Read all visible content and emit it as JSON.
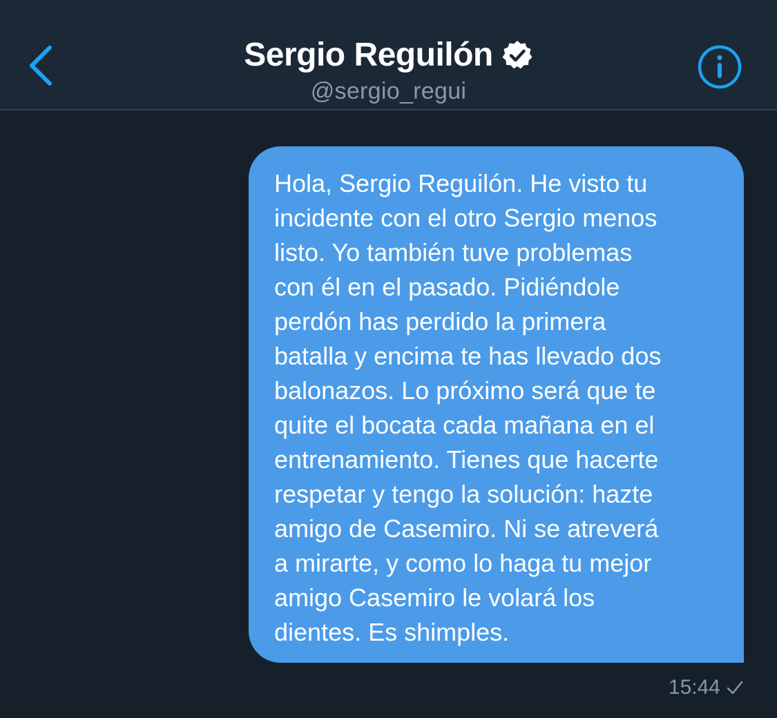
{
  "header": {
    "name": "Sergio Reguilón",
    "handle": "@sergio_regui",
    "back_icon": "chevron-left-icon",
    "verified_icon": "verified-badge-icon",
    "info_icon": "info-icon"
  },
  "conversation": {
    "messages": [
      {
        "text": "Hola, Sergio Reguilón. He visto tu\nincidente con el otro Sergio menos\nlisto. Yo también tuve problemas\ncon él en el pasado. Pidiéndole\nperdón has perdido la primera\nbatalla y encima te has llevado dos\nbalonazos. Lo próximo será que te\nquite el bocata cada mañana en el\nentrenamiento. Tienes que hacerte\nrespetar y tengo la solución: hazte\namigo de Casemiro. Ni se atreverá\na mirarte, y como lo haga tu mejor\namigo Casemiro le volará los\ndientes. Es shimples.",
        "time": "15:44",
        "status_icon": "sent-check-icon"
      }
    ]
  },
  "colors": {
    "background": "#15202b",
    "header_background": "#1b2836",
    "accent": "#1da1f2",
    "bubble": "#4b9be8",
    "muted_text": "#8899a6"
  }
}
